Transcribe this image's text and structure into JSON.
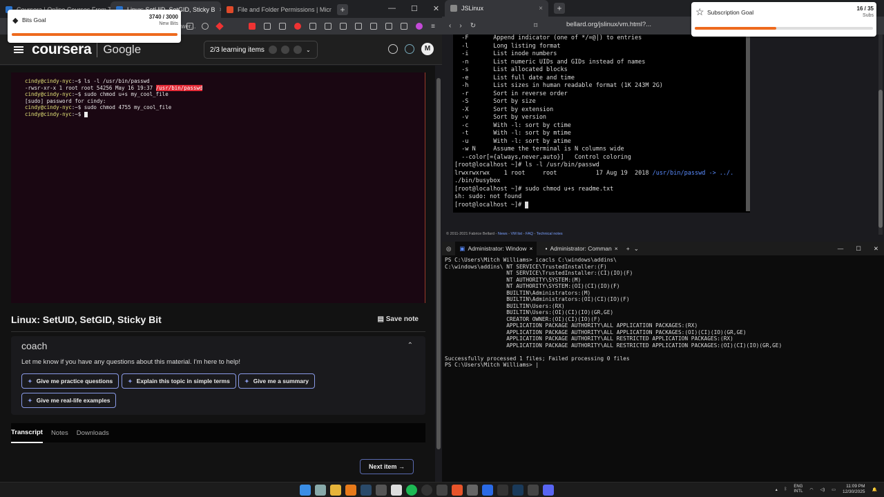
{
  "left_browser": {
    "tabs": [
      {
        "title": "Coursera | Online Courses From Top",
        "color": "#2a73cc"
      },
      {
        "title": "Linux: SetUID, SetGID, Sticky B",
        "color": "#2a73cc"
      },
      {
        "title": "File and Folder Permissions | Microso",
        "color": "#e04a2a"
      }
    ],
    "new_tab": "+",
    "toolbar_partial_text": "wer...",
    "header": {
      "brand": "coursera",
      "partner": "Google",
      "learning_items": "2/3 learning items",
      "avatar_initial": "M"
    },
    "terminal_lines": [
      {
        "prompt": "cindy@cindy-nyc",
        "path": ":~$ ",
        "cmd": "ls -l /usr/bin/passwd"
      },
      {
        "plain": "-rwsr-xr-x 1 root root 54256 May 16 19:37 ",
        "highlight": "/usr/bin/passwd"
      },
      {
        "prompt": "cindy@cindy-nyc",
        "path": ":~$ ",
        "cmd": "sudo chmod u+s my_cool_file"
      },
      {
        "plain": "[sudo] password for cindy:"
      },
      {
        "prompt": "cindy@cindy-nyc",
        "path": ":~$ ",
        "cmd": "sudo chmod 4755 my_cool_file"
      },
      {
        "prompt": "cindy@cindy-nyc",
        "path": ":~$ ",
        "cmd": ""
      }
    ],
    "lesson_title": "Linux: SetUID, SetGID, Sticky Bit",
    "save_note": "Save note",
    "coach": {
      "brand": "coach",
      "message": "Let me know if you have any questions about this material. I'm here to help!",
      "chips": [
        "Give me practice questions",
        "Explain this topic in simple terms",
        "Give me a summary",
        "Give me real-life examples"
      ]
    },
    "content_tabs": [
      "Transcript",
      "Notes",
      "Downloads"
    ],
    "next_item": "Next item"
  },
  "bits_goal": {
    "label": "Bits Goal",
    "value": "3740 / 3000",
    "sub": "New Bits",
    "progress": 1.0
  },
  "sub_goal": {
    "label": "Subscription Goal",
    "value": "16 / 35",
    "sub": "Subs",
    "progress": 0.457
  },
  "right_browser": {
    "tab_title": "JSLinux",
    "url": "bellard.org/jslinux/vm.html?...",
    "terminal_text": "  -F       Append indicator (one of */=@|) to entries\n  -l       Long listing format\n  -i       List inode numbers\n  -n       List numeric UIDs and GIDs instead of names\n  -s       List allocated blocks\n  -e       List full date and time\n  -h       List sizes in human readable format (1K 243M 2G)\n  -r       Sort in reverse order\n  -S       Sort by size\n  -X       Sort by extension\n  -v       Sort by version\n  -c       With -l: sort by ctime\n  -t       With -l: sort by mtime\n  -u       With -l: sort by atime\n  -w N     Assume the terminal is N columns wide\n  --color[={always,never,auto}]   Control coloring\n[root@localhost ~]# ls -l /usr/bin/passwd\nlrwxrwxrwx    1 root     root           17 Aug 19  2018 ",
    "link_path": "/usr/bin/passwd -> ../.",
    "terminal_tail": "\n./bin/busybox\n[root@localhost ~]# sudo chmod u+s readme.txt\nsh: sudo: not found\n[root@localhost ~]# ",
    "copyright": "© 2011-2021 Fabrice Bellard - ",
    "links": [
      "News",
      "VM list",
      "FAQ",
      "Technical notes"
    ]
  },
  "powershell": {
    "tabs": [
      "Administrator: Window",
      "Administrator: Comman"
    ],
    "output": "PS C:\\Users\\Mitch Williams> icacls C:\\windows\\addins\\\nC:\\windows\\addins\\ NT SERVICE\\TrustedInstaller:(F)\n                   NT SERVICE\\TrustedInstaller:(CI)(IO)(F)\n                   NT AUTHORITY\\SYSTEM:(M)\n                   NT AUTHORITY\\SYSTEM:(OI)(CI)(IO)(F)\n                   BUILTIN\\Administrators:(M)\n                   BUILTIN\\Administrators:(OI)(CI)(IO)(F)\n                   BUILTIN\\Users:(RX)\n                   BUILTIN\\Users:(OI)(CI)(IO)(GR,GE)\n                   CREATOR OWNER:(OI)(CI)(IO)(F)\n                   APPLICATION PACKAGE AUTHORITY\\ALL APPLICATION PACKAGES:(RX)\n                   APPLICATION PACKAGE AUTHORITY\\ALL APPLICATION PACKAGES:(OI)(CI)(IO)(GR,GE)\n                   APPLICATION PACKAGE AUTHORITY\\ALL RESTRICTED APPLICATION PACKAGES:(RX)\n                   APPLICATION PACKAGE AUTHORITY\\ALL RESTRICTED APPLICATION PACKAGES:(OI)(CI)(IO)(GR,GE)\n\nSuccessfully processed 1 files; Failed processing 0 files\nPS C:\\Users\\Mitch Williams> |"
  },
  "taskbar": {
    "lang": "ENG",
    "lang_sub": "INTL",
    "time": "11:09 PM",
    "date": "12/30/2025"
  }
}
